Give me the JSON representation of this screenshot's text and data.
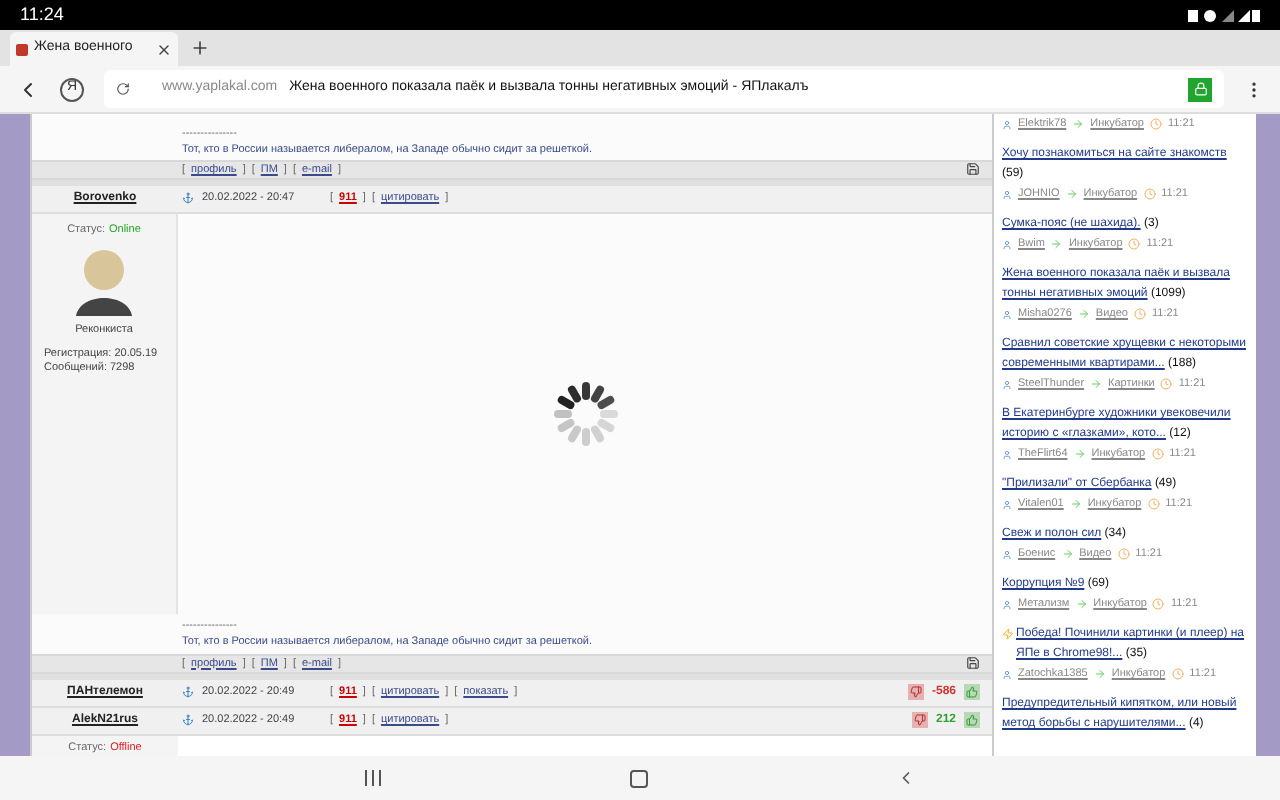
{
  "status_bar": {
    "time": "11:24"
  },
  "browser": {
    "tab_title": "Жена военного",
    "url_domain": "www.yaplakal.com",
    "page_title": "Жена военного показала паёк и вызвала тонны негативных эмоций - ЯПлакалъ",
    "yandex_letter": "Я"
  },
  "markup": {
    "open": "[",
    "close": "]",
    "rule": "---------------"
  },
  "top_post": {
    "signature": "Тот, кто в России называется либералом, на Западе обычно сидит за решеткой.",
    "links": [
      "профиль",
      "ПМ",
      "e-mail"
    ]
  },
  "posts": [
    {
      "kind": "full",
      "author": "Borovenko",
      "date": "20.02.2022 - 20:47",
      "rating_link": "911",
      "actions": [
        "цитировать"
      ],
      "status_label": "Статус:",
      "status": "Online",
      "online": true,
      "rank": "Реконкиста",
      "registration": "Регистрация: 20.05.19",
      "messages": "Сообщений: 7298",
      "loading": true,
      "signature": "Тот, кто в России называется либералом, на Западе обычно сидит за решеткой.",
      "links": [
        "профиль",
        "ПМ",
        "e-mail"
      ]
    },
    {
      "kind": "header",
      "author": "ПАНтелемон",
      "date": "20.02.2022 - 20:49",
      "rating_link": "911",
      "actions": [
        "цитировать",
        "показать"
      ],
      "score": "-586",
      "negative": true
    },
    {
      "kind": "header",
      "author": "AlekN21rus",
      "date": "20.02.2022 - 20:49",
      "rating_link": "911",
      "actions": [
        "цитировать"
      ],
      "score": "212",
      "negative": false,
      "status_label": "Статус:",
      "status": "Offline",
      "online": false
    }
  ],
  "sidebar": {
    "first_meta": {
      "user": "Elektrik78",
      "section": "Инкубатор",
      "time": "11:21"
    },
    "items": [
      {
        "title": "Хочу познакомиться на сайте знакомств",
        "count": "(59)",
        "user": "JOHNIO",
        "section": "Инкубатор",
        "time": "11:21",
        "flash": false
      },
      {
        "title": "Сумка-пояс (не шахида).",
        "count": "(3)",
        "user": "Bwim",
        "section": "Инкубатор",
        "time": "11:21",
        "flash": false
      },
      {
        "title": "Жена военного показала паёк и вызвала тонны негативных эмоций",
        "count": "(1099)",
        "user": "Misha0276",
        "section": "Видео",
        "time": "11:21",
        "flash": false
      },
      {
        "title": "Сравнил советские хрущевки с некоторыми современными квартирами...",
        "count": "(188)",
        "user": "SteelThunder",
        "section": "Картинки",
        "time": "11:21",
        "flash": false
      },
      {
        "title": "В Екатеринбурге художники увековечили историю с «глазками», кото...",
        "count": "(12)",
        "user": "TheFlirt64",
        "section": "Инкубатор",
        "time": "11:21",
        "flash": false
      },
      {
        "title": "\"Прилизали\" от Сбербанка",
        "count": "(49)",
        "user": "Vitalen01",
        "section": "Инкубатор",
        "time": "11:21",
        "flash": false
      },
      {
        "title": "Свеж и полон сил",
        "count": "(34)",
        "user": "Боенис",
        "section": "Видео",
        "time": "11:21",
        "flash": false
      },
      {
        "title": "Коррупция №9",
        "count": "(69)",
        "user": "Метализм",
        "section": "Инкубатор",
        "time": "11:21",
        "flash": false
      },
      {
        "title": "Победа! Починили картинки (и плеер) на ЯПе в Chrome98!...",
        "count": "(35)",
        "user": "Zatochka1385",
        "section": "Инкубатор",
        "time": "11:21",
        "flash": true
      },
      {
        "title": "Предупредительный кипятком, или новый метод борьбы с нарушителями...",
        "count": "(4)",
        "flash": false
      }
    ]
  }
}
